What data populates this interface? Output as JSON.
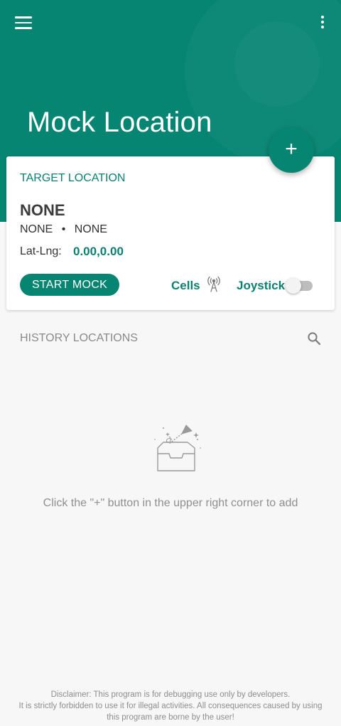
{
  "app": {
    "title": "Mock Location"
  },
  "header": {
    "menu_icon": "hamburger-menu-icon",
    "more_icon": "more-vert-icon"
  },
  "fab": {
    "label": "+",
    "icon": "plus-icon"
  },
  "target_card": {
    "section_label": "TARGET LOCATION",
    "place_name": "NONE",
    "place_detail_a": "NONE",
    "separator": "•",
    "place_detail_b": "NONE",
    "latlng_label": "Lat-Lng:",
    "latlng_value": "0.00,0.00",
    "start_button": "START MOCK",
    "cells_label": "Cells",
    "cells_icon": "antenna-icon",
    "joystick_label": "Joystick",
    "joystick_enabled": false
  },
  "history": {
    "section_label": "HISTORY LOCATIONS",
    "search_icon": "search-icon",
    "empty_text": "Click the \"+\" button in the upper right corner to add",
    "empty_icon": "empty-inbox-paper-plane-icon"
  },
  "disclaimer": {
    "line1": "Disclaimer: This program is for debugging use only by developers.",
    "line2": "It is strictly forbidden to use it for illegal activities. All consequences caused by using",
    "line3": "this program are borne by the user!"
  },
  "colors": {
    "primary": "#068573",
    "accent_text": "#0b7f70",
    "background": "#f7f7f7",
    "muted_text": "#8a8a8a"
  }
}
